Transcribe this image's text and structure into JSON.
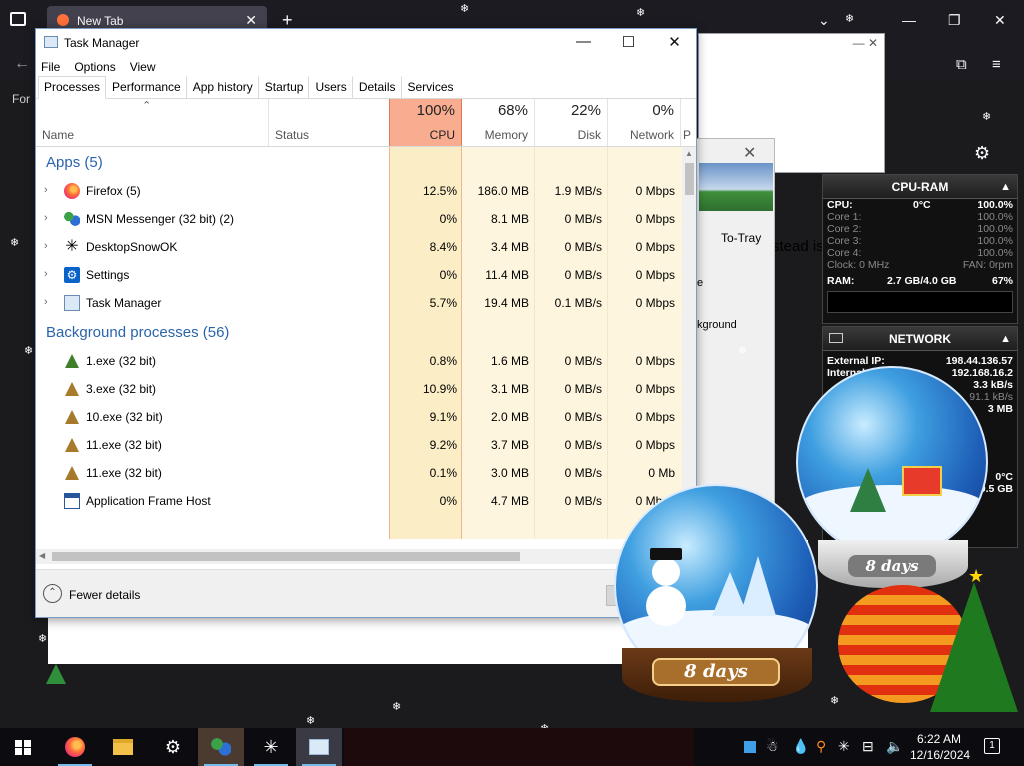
{
  "firefox": {
    "tab_title": "New Tab",
    "page_text_left": "For",
    "page_fragment": "stead is"
  },
  "task_manager": {
    "title": "Task Manager",
    "menu": [
      "File",
      "Options",
      "View"
    ],
    "tabs": [
      "Processes",
      "Performance",
      "App history",
      "Startup",
      "Users",
      "Details",
      "Services"
    ],
    "active_tab": "Processes",
    "columns": {
      "name": "Name",
      "status": "Status",
      "cpu": {
        "pct": "100%",
        "label": "CPU"
      },
      "memory": {
        "pct": "68%",
        "label": "Memory"
      },
      "disk": {
        "pct": "22%",
        "label": "Disk"
      },
      "network": {
        "pct": "0%",
        "label": "Network"
      },
      "extra": "P"
    },
    "groups": {
      "apps": "Apps (5)",
      "background": "Background processes (56)"
    },
    "apps": [
      {
        "name": "Firefox (5)",
        "cpu": "12.5%",
        "memory": "186.0 MB",
        "disk": "1.9 MB/s",
        "network": "0 Mbps"
      },
      {
        "name": "MSN Messenger (32 bit) (2)",
        "cpu": "0%",
        "memory": "8.1 MB",
        "disk": "0 MB/s",
        "network": "0 Mbps"
      },
      {
        "name": "DesktopSnowOK",
        "cpu": "8.4%",
        "memory": "3.4 MB",
        "disk": "0 MB/s",
        "network": "0 Mbps"
      },
      {
        "name": "Settings",
        "cpu": "0%",
        "memory": "11.4 MB",
        "disk": "0 MB/s",
        "network": "0 Mbps"
      },
      {
        "name": "Task Manager",
        "cpu": "5.7%",
        "memory": "19.4 MB",
        "disk": "0.1 MB/s",
        "network": "0 Mbps"
      }
    ],
    "background": [
      {
        "name": "1.exe (32 bit)",
        "cpu": "0.8%",
        "memory": "1.6 MB",
        "disk": "0 MB/s",
        "network": "0 Mbps"
      },
      {
        "name": "3.exe (32 bit)",
        "cpu": "10.9%",
        "memory": "3.1 MB",
        "disk": "0 MB/s",
        "network": "0 Mbps"
      },
      {
        "name": "10.exe (32 bit)",
        "cpu": "9.1%",
        "memory": "2.0 MB",
        "disk": "0 MB/s",
        "network": "0 Mbps"
      },
      {
        "name": "11.exe (32 bit)",
        "cpu": "9.2%",
        "memory": "3.7 MB",
        "disk": "0 MB/s",
        "network": "0 Mbps"
      },
      {
        "name": "11.exe (32 bit)",
        "cpu": "0.1%",
        "memory": "3.0 MB",
        "disk": "0 MB/s",
        "network": "0 Mb"
      },
      {
        "name": "Application Frame Host",
        "cpu": "0%",
        "memory": "4.7 MB",
        "disk": "0 MB/s",
        "network": "0 Mbps"
      }
    ],
    "fewer_details": "Fewer details"
  },
  "to_tray": {
    "label": "To-Tray",
    "frag1": "e",
    "frag2": "kground"
  },
  "cpu_ram_gadget": {
    "title": "CPU-RAM",
    "cpu_label": "CPU:",
    "temp": "0°C",
    "cpu_value": "100.0%",
    "cores": [
      {
        "label": "Core 1:",
        "value": "100.0%"
      },
      {
        "label": "Core 2:",
        "value": "100.0%"
      },
      {
        "label": "Core 3:",
        "value": "100.0%"
      },
      {
        "label": "Core 4:",
        "value": "100.0%"
      }
    ],
    "clock": "Clock: 0 MHz",
    "fan": "FAN: 0rpm",
    "ram_label": "RAM:",
    "ram_value": "2.7 GB/4.0 GB",
    "ram_pct": "67%"
  },
  "network_gadget": {
    "title": "NETWORK",
    "external_label": "External IP:",
    "external_ip": "198.44.136.57",
    "internal_label": "Internal",
    "internal_ip": "192.168.16.2",
    "rate1": "3.3 kB/s",
    "rate2": "91.1 kB/s",
    "rate3": "3 MB"
  },
  "extra_gadget": {
    "temp": "0°C",
    "size": "9.5 GB"
  },
  "globes": {
    "small_badge": "8 days",
    "large_badge": "8 days"
  },
  "taskbar": {
    "time": "6:22 AM",
    "date": "12/16/2024"
  }
}
